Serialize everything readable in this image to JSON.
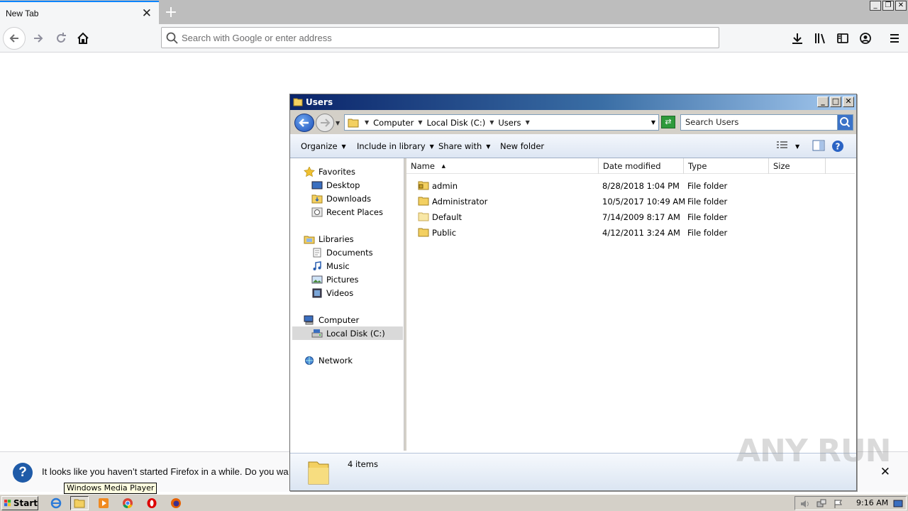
{
  "browser": {
    "tab_title": "New Tab",
    "new_tab_symbol": "+",
    "url_placeholder": "Search with Google or enter address",
    "accent": "#0a84ff"
  },
  "notification": {
    "message": "It looks like you haven’t started Firefox in a while. Do you wa",
    "close_symbol": "✕"
  },
  "explorer": {
    "title": "Users",
    "breadcrumbs": [
      "Computer",
      "Local Disk (C:)",
      "Users"
    ],
    "search_placeholder": "Search Users",
    "toolbar": {
      "organize": "Organize",
      "include_in_library": "Include in library",
      "share_with": "Share with",
      "new_folder": "New folder"
    },
    "nav": {
      "favorites": "Favorites",
      "desktop": "Desktop",
      "downloads": "Downloads",
      "recent_places": "Recent Places",
      "libraries": "Libraries",
      "documents": "Documents",
      "music": "Music",
      "pictures": "Pictures",
      "videos": "Videos",
      "computer": "Computer",
      "local_disk": "Local Disk (C:)",
      "network": "Network"
    },
    "columns": {
      "name": "Name",
      "date": "Date modified",
      "type": "Type",
      "size": "Size"
    },
    "files": [
      {
        "name": "admin",
        "date": "8/28/2018 1:04 PM",
        "type": "File folder",
        "size": ""
      },
      {
        "name": "Administrator",
        "date": "10/5/2017 10:49 AM",
        "type": "File folder",
        "size": ""
      },
      {
        "name": "Default",
        "date": "7/14/2009 8:17 AM",
        "type": "File folder",
        "size": ""
      },
      {
        "name": "Public",
        "date": "4/12/2011 3:24 AM",
        "type": "File folder",
        "size": ""
      }
    ],
    "status": "4 items"
  },
  "tooltip": "Windows Media Player",
  "taskbar": {
    "start": "Start",
    "clock": "9:16 AM"
  },
  "watermark": "ANY RUN"
}
